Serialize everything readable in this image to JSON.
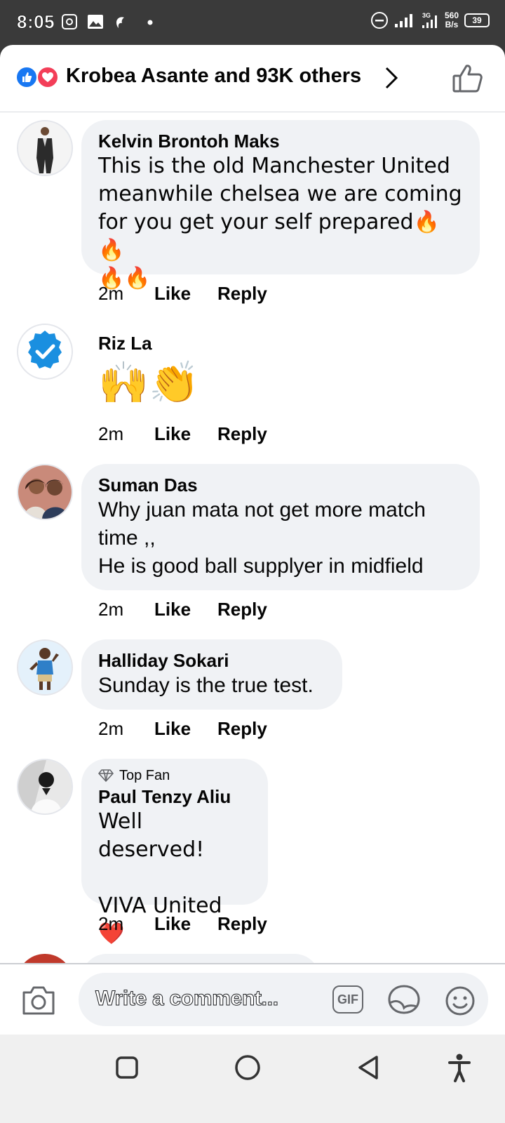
{
  "status_bar": {
    "time": "8:05",
    "net_speed_value": "560",
    "net_speed_unit": "B/s",
    "battery": "39",
    "network_label": "3G"
  },
  "header": {
    "reactions_text": "Krobea Asante and 93K others"
  },
  "comments": [
    {
      "author": "Kelvin Brontoh Maks",
      "text": "This is the old Manchester United meanwhile chelsea we are coming for you get your self prepared🔥🔥\n🔥🔥",
      "time": "2m",
      "like": "Like",
      "reply": "Reply"
    },
    {
      "author": "Riz La",
      "text": "🙌👏",
      "time": "2m",
      "like": "Like",
      "reply": "Reply"
    },
    {
      "author": "Suman Das",
      "text": "Why juan mata not get more match time ,,\nHe is good ball supplyer in midfield",
      "time": "2m",
      "like": "Like",
      "reply": "Reply"
    },
    {
      "author": "Halliday Sokari",
      "text": "Sunday is the true test.",
      "time": "2m",
      "like": "Like",
      "reply": "Reply"
    },
    {
      "badge": "Top Fan",
      "author": "Paul Tenzy Aliu",
      "text": "Well deserved!\n\nVIVA United ❤️",
      "time": "2m",
      "like": "Like",
      "reply": "Reply"
    }
  ],
  "composer": {
    "placeholder": "Write a comment...",
    "gif_label": "GIF"
  },
  "colors": {
    "facebook_blue": "#1877f2",
    "love_red": "#f33e58",
    "bubble_gray": "#f0f2f5"
  }
}
